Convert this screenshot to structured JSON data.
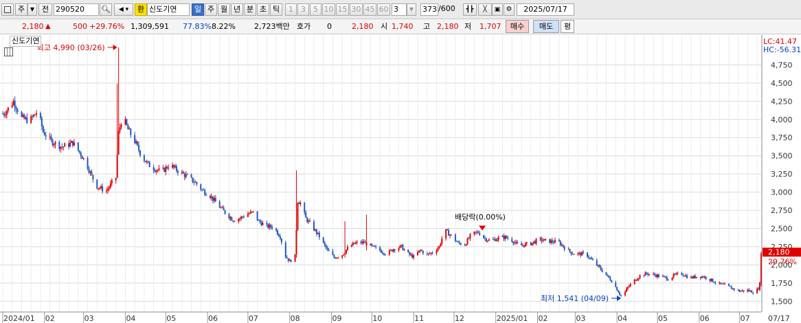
{
  "toolbar": {
    "period_button": "주",
    "prev_label": "전",
    "code": "290520",
    "exchange_badge": "환",
    "stock_name": "신도기연",
    "periods": [
      "일",
      "주",
      "월",
      "년",
      "분",
      "초",
      "틱"
    ],
    "selected_period": "일",
    "intervals": [
      "1",
      "3",
      "5",
      "10",
      "15",
      "30",
      "45",
      "60"
    ],
    "custom_interval": "3",
    "count": "373",
    "count_max": "/600",
    "date": "2025/07/17",
    "icons": [
      "layout-icon",
      "down-arrow-icon",
      "search-icon",
      "speaker-icon",
      "candle-type-icon",
      "draw-tools-icon",
      "save-icon",
      "settings-icon"
    ]
  },
  "info": {
    "price": "2,180",
    "change": "500",
    "change_pct": "+29.76%",
    "volume": "1,309,591",
    "turnover_pct": "77.83%",
    "ratio": "8.22%",
    "amount": "2,723백만",
    "quote_label": "호가",
    "quote_value": "0",
    "quote_price": "2,180",
    "open_label": "시",
    "open": "1,740",
    "high_label": "고",
    "high": "2,180",
    "low_label": "저",
    "low": "1,707",
    "buy_button": "매수",
    "sell_button": "매도",
    "avg_button": "평"
  },
  "stock_tag": "신도기연",
  "chart_data": {
    "type": "candlestick",
    "y_ticks": [
      1500,
      1750,
      2000,
      2250,
      2500,
      2750,
      3000,
      3250,
      3500,
      3750,
      4000,
      4250,
      4500,
      4750
    ],
    "y_tick_labels": [
      "1,500",
      "1,750",
      "2,000",
      "2,250",
      "2,500",
      "2,750",
      "3,000",
      "3,250",
      "3,500",
      "3,750",
      "4,000",
      "4,250",
      "4,500",
      "4,750"
    ],
    "ylim": [
      1390,
      4990
    ],
    "x_labels": [
      "2024/01",
      "02",
      "03",
      "04",
      "05",
      "06",
      "07",
      "08",
      "09",
      "10",
      "11",
      "12",
      "2025/01",
      "02",
      "03",
      "04",
      "05",
      "06",
      "07"
    ],
    "x_label_days": [
      0,
      31,
      60,
      91,
      121,
      152,
      182,
      213,
      244,
      274,
      305,
      335,
      366,
      397,
      425,
      456,
      486,
      517,
      547
    ],
    "x_end_label": "07/17",
    "x_end_day": 563,
    "trend_points": [
      [
        1,
        4080
      ],
      [
        4,
        4150
      ],
      [
        8,
        4250
      ],
      [
        14,
        4020
      ],
      [
        20,
        3980
      ],
      [
        26,
        4120
      ],
      [
        30,
        3830
      ],
      [
        36,
        3700
      ],
      [
        44,
        3620
      ],
      [
        52,
        3680
      ],
      [
        58,
        3520
      ],
      [
        62,
        3400
      ],
      [
        66,
        3220
      ],
      [
        70,
        3080
      ],
      [
        74,
        3040
      ],
      [
        77,
        3020
      ],
      [
        80,
        3100
      ],
      [
        84,
        3200
      ],
      [
        86,
        3820
      ],
      [
        89,
        4050
      ],
      [
        93,
        3860
      ],
      [
        98,
        3700
      ],
      [
        103,
        3500
      ],
      [
        108,
        3380
      ],
      [
        113,
        3320
      ],
      [
        118,
        3280
      ],
      [
        124,
        3380
      ],
      [
        128,
        3320
      ],
      [
        133,
        3260
      ],
      [
        138,
        3200
      ],
      [
        143,
        3130
      ],
      [
        148,
        3030
      ],
      [
        154,
        2950
      ],
      [
        160,
        2820
      ],
      [
        166,
        2700
      ],
      [
        171,
        2620
      ],
      [
        176,
        2640
      ],
      [
        181,
        2700
      ],
      [
        186,
        2720
      ],
      [
        190,
        2600
      ],
      [
        196,
        2530
      ],
      [
        201,
        2520
      ],
      [
        206,
        2390
      ],
      [
        210,
        2120
      ],
      [
        213,
        2050
      ],
      [
        217,
        2120
      ],
      [
        219,
        2880
      ],
      [
        221,
        2850
      ],
      [
        225,
        2640
      ],
      [
        230,
        2520
      ],
      [
        235,
        2390
      ],
      [
        241,
        2200
      ],
      [
        246,
        2100
      ],
      [
        252,
        2140
      ],
      [
        257,
        2250
      ],
      [
        262,
        2300
      ],
      [
        268,
        2310
      ],
      [
        274,
        2250
      ],
      [
        280,
        2200
      ],
      [
        285,
        2150
      ],
      [
        290,
        2220
      ],
      [
        296,
        2250
      ],
      [
        300,
        2160
      ],
      [
        305,
        2110
      ],
      [
        310,
        2200
      ],
      [
        315,
        2140
      ],
      [
        319,
        2170
      ],
      [
        324,
        2250
      ],
      [
        328,
        2480
      ],
      [
        333,
        2400
      ],
      [
        338,
        2300
      ],
      [
        343,
        2280
      ],
      [
        348,
        2420
      ],
      [
        353,
        2450
      ],
      [
        358,
        2360
      ],
      [
        363,
        2330
      ],
      [
        368,
        2370
      ],
      [
        373,
        2380
      ],
      [
        378,
        2340
      ],
      [
        383,
        2260
      ],
      [
        388,
        2280
      ],
      [
        393,
        2300
      ],
      [
        398,
        2350
      ],
      [
        403,
        2330
      ],
      [
        408,
        2320
      ],
      [
        413,
        2310
      ],
      [
        418,
        2220
      ],
      [
        423,
        2160
      ],
      [
        428,
        2150
      ],
      [
        433,
        2150
      ],
      [
        438,
        2050
      ],
      [
        443,
        1960
      ],
      [
        448,
        1860
      ],
      [
        453,
        1760
      ],
      [
        458,
        1600
      ],
      [
        460,
        1560
      ],
      [
        464,
        1690
      ],
      [
        468,
        1770
      ],
      [
        473,
        1850
      ],
      [
        478,
        1880
      ],
      [
        484,
        1860
      ],
      [
        489,
        1840
      ],
      [
        494,
        1810
      ],
      [
        499,
        1860
      ],
      [
        504,
        1880
      ],
      [
        510,
        1820
      ],
      [
        515,
        1840
      ],
      [
        520,
        1840
      ],
      [
        526,
        1790
      ],
      [
        531,
        1740
      ],
      [
        536,
        1720
      ],
      [
        541,
        1680
      ],
      [
        547,
        1640
      ],
      [
        553,
        1650
      ],
      [
        558,
        1620
      ],
      [
        561,
        1680
      ],
      [
        562,
        1740
      ],
      [
        563,
        2180
      ]
    ],
    "spikes": [
      {
        "day": 86,
        "high": 4990,
        "low": 3750
      },
      {
        "day": 85,
        "high": 4490,
        "low": 3200
      },
      {
        "day": 218,
        "high": 3300,
        "low": 2100
      },
      {
        "day": 327,
        "high": 2840,
        "low": 2200
      },
      {
        "day": 270,
        "high": 2690,
        "low": 2200
      },
      {
        "day": 254,
        "high": 2600,
        "low": 2100
      },
      {
        "day": 563,
        "high": 2180,
        "low": 1707
      }
    ],
    "last_close": 2180,
    "annotations": [
      {
        "text": "최고 4,990 (03/26)",
        "day": 86,
        "value": 4990,
        "side": "left",
        "color": "#e00000"
      },
      {
        "text": "최저 1,541 (04/09)",
        "day": 460,
        "value": 1541,
        "side": "left",
        "color": "#0040c8"
      },
      {
        "text": "배당락(0.00%)",
        "day": 356,
        "value": 2530,
        "side": "above",
        "color": "#000000"
      }
    ],
    "lc_label": "LC:41.47",
    "hc_label": "HC:-56.31",
    "last_price_label": "2,180",
    "last_pct_label": "29.76%",
    "colors": {
      "up": "#e00000",
      "down": "#1f57c6",
      "grid": "#d9d9d9",
      "price_tag": "#e00000"
    }
  }
}
